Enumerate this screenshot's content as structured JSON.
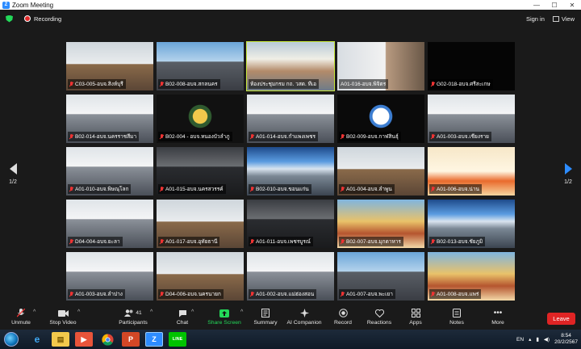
{
  "window": {
    "title": "Zoom Meeting"
  },
  "topbar": {
    "recording_label": "Recording",
    "sign_in": "Sign in",
    "view": "View"
  },
  "pagination": {
    "left": "1/2",
    "right": "1/2"
  },
  "tiles": [
    {
      "label": "C03-005-อบจ.สิงห์บุรี",
      "muted": true,
      "scene": "office"
    },
    {
      "label": "B02-008-อบจ.สกลนคร",
      "muted": true,
      "scene": "banner"
    },
    {
      "label": "ห้องประชุมกรม กถ. วสด. ทีเอ",
      "muted": false,
      "scene": "building",
      "active": true
    },
    {
      "label": "A01-016-อบจ.พิจิตร",
      "muted": false,
      "scene": "person"
    },
    {
      "label": "G02-018-อบจ.ศรีสะเกษ",
      "muted": true,
      "scene": "black"
    },
    {
      "label": "B02-014-อบจ.นครราชสีมา",
      "muted": true,
      "scene": "meeting"
    },
    {
      "label": "B02-004 - อบจ.หนองบัวลำภู",
      "muted": true,
      "scene": "emblem"
    },
    {
      "label": "A01-014-อบจ.กำแพงเพชร",
      "muted": true,
      "scene": "meeting"
    },
    {
      "label": "B02-009-อบจ.กาฬสินธุ์",
      "muted": true,
      "scene": "logo"
    },
    {
      "label": "A01-003-อบจ.เชียงราย",
      "muted": true,
      "scene": "meeting"
    },
    {
      "label": "A01-010-อบจ.พิษณุโลก",
      "muted": true,
      "scene": "meeting"
    },
    {
      "label": "A01-015-อบจ.นครสวรรค์",
      "muted": true,
      "scene": "dark"
    },
    {
      "label": "B02-010-อบจ.ขอนแก่น",
      "muted": true,
      "scene": "screen"
    },
    {
      "label": "A01-004-อบจ.ลำพูน",
      "muted": true,
      "scene": "office"
    },
    {
      "label": "A01-006-อบจ.น่าน",
      "muted": true,
      "scene": "poster"
    },
    {
      "label": "D04-004-อบจ.ยะลา",
      "muted": true,
      "scene": "meeting"
    },
    {
      "label": "A01-017-อบจ.อุทัยธานี",
      "muted": true,
      "scene": "office"
    },
    {
      "label": "A01-011-อบจ.เพชรบูรณ์",
      "muted": true,
      "scene": "dark"
    },
    {
      "label": "B02-007-อบจ.มุกดาหาร",
      "muted": true,
      "scene": "temple"
    },
    {
      "label": "B02-013-อบจ.ชัยภูมิ",
      "muted": true,
      "scene": "screen"
    },
    {
      "label": "A01-003-อบจ.ลำปาง",
      "muted": true,
      "scene": "meeting"
    },
    {
      "label": "D04-006-อบจ.นครนายก",
      "muted": true,
      "scene": "office"
    },
    {
      "label": "A01-002-อบจ.แม่ฮ่องสอน",
      "muted": true,
      "scene": "meeting"
    },
    {
      "label": "A01-007-อบจ.พะเยา",
      "muted": true,
      "scene": "banner"
    },
    {
      "label": "A01-008-อบจ.แพร่",
      "muted": true,
      "scene": "temple"
    }
  ],
  "toolbar": {
    "unmute": "Unmute",
    "stop_video": "Stop Video",
    "participants": "Participants",
    "participant_count": "41",
    "chat": "Chat",
    "share_screen": "Share Screen",
    "summary": "Summary",
    "ai_companion": "AI Companion",
    "record": "Record",
    "reactions": "Reactions",
    "apps": "Apps",
    "notes": "Notes",
    "more": "More",
    "leave": "Leave"
  },
  "taskbar": {
    "language": "EN",
    "time": "8:54",
    "date": "20/2/2567"
  },
  "colors": {
    "accent": "#2d8cff",
    "share_green": "#23d959",
    "leave_red": "#e02424",
    "active_border": "#c8e93a"
  }
}
